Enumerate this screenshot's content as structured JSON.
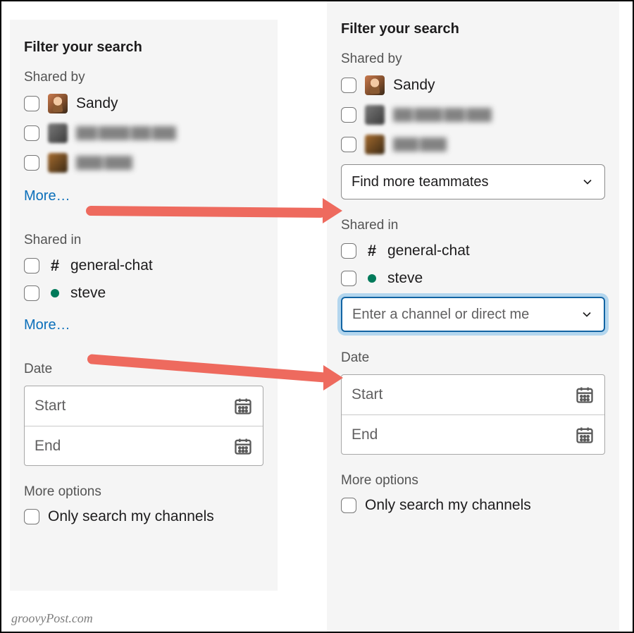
{
  "left": {
    "heading": "Filter your search",
    "shared_by_label": "Shared by",
    "people": {
      "sandy": "Sandy"
    },
    "more_link": "More…",
    "shared_in_label": "Shared in",
    "channels": {
      "general": "general-chat",
      "steve": "steve"
    },
    "more_link2": "More…",
    "date_label": "Date",
    "date_start": "Start",
    "date_end": "End",
    "more_options_label": "More options",
    "only_my_channels": "Only search my channels"
  },
  "right": {
    "heading": "Filter your search",
    "shared_by_label": "Shared by",
    "people": {
      "sandy": "Sandy"
    },
    "find_more_teammates": "Find more teammates",
    "shared_in_label": "Shared in",
    "channels": {
      "general": "general-chat",
      "steve": "steve"
    },
    "enter_channel_placeholder": "Enter a channel or direct me",
    "date_label": "Date",
    "date_start": "Start",
    "date_end": "End",
    "more_options_label": "More options",
    "only_my_channels": "Only search my channels"
  },
  "attribution": "groovyPost.com"
}
